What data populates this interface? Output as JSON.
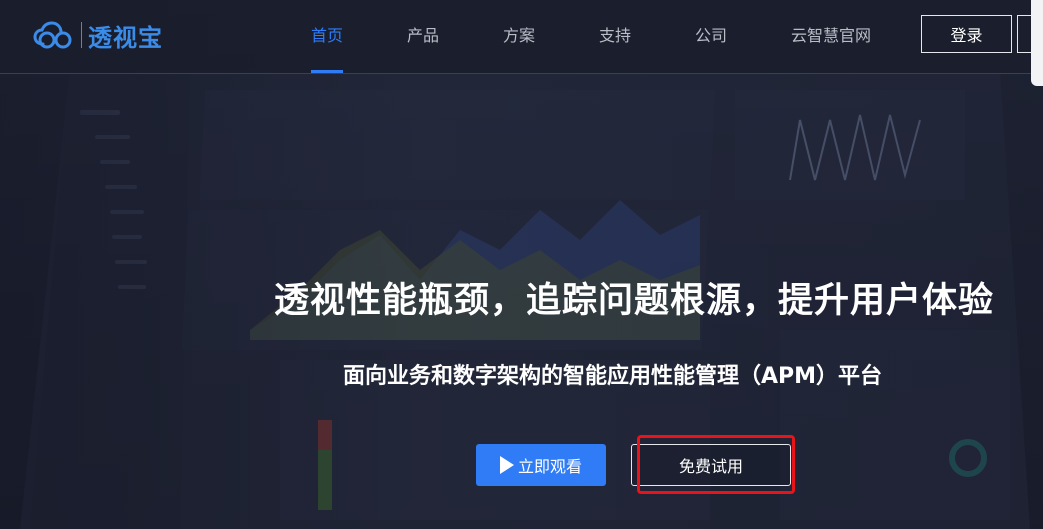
{
  "brand": {
    "name": "透视宝",
    "accent": "#2f7cf6",
    "logo_color": "#3b8be8"
  },
  "nav": {
    "items": [
      {
        "label": "首页",
        "active": true
      },
      {
        "label": "产品",
        "active": false
      },
      {
        "label": "方案",
        "active": false
      },
      {
        "label": "支持",
        "active": false
      },
      {
        "label": "公司",
        "active": false
      },
      {
        "label": "云智慧官网",
        "active": false
      }
    ],
    "login_label": "登录"
  },
  "hero": {
    "title": "透视性能瓶颈，追踪问题根源，提升用户体验",
    "subtitle": "面向业务和数字架构的智能应用性能管理（APM）平台",
    "watch_label": "立即观看",
    "trial_label": "免费试用"
  },
  "colors": {
    "highlight_box": "#e8141a",
    "header_bg": "#1a1e2d",
    "page_bg": "#1e2233"
  },
  "icons": {
    "logo": "cloud-link-icon",
    "play": "play-icon"
  }
}
